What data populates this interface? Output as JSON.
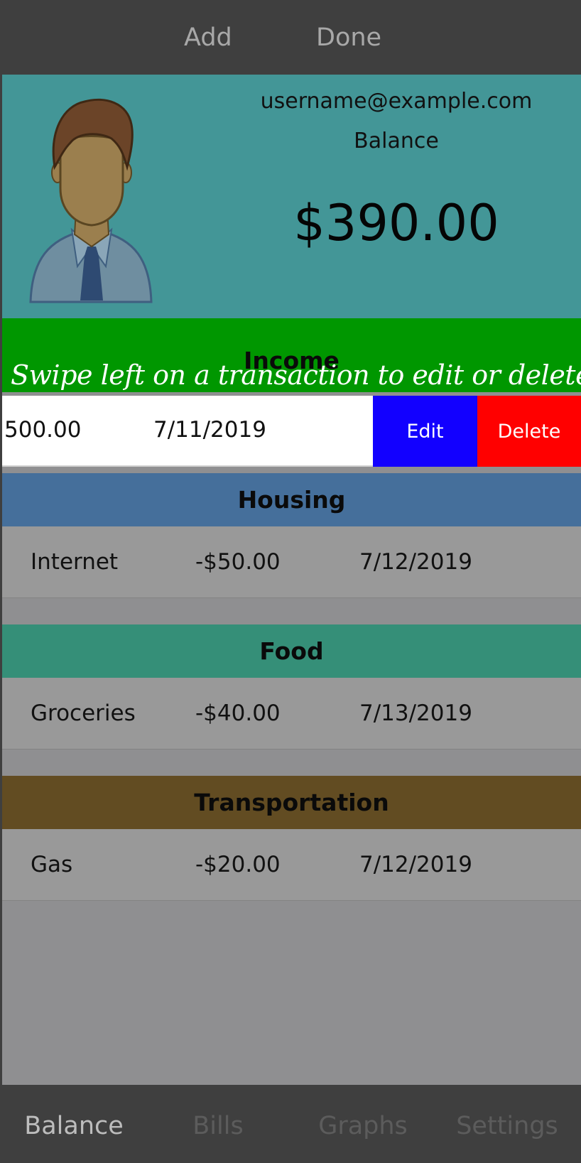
{
  "navbar": {
    "add_label": "Add",
    "done_label": "Done"
  },
  "profile": {
    "email": "username@example.com",
    "balance_label": "Balance",
    "balance_amount": "$390.00"
  },
  "income": {
    "title": "Income",
    "swipe_hint": "Swipe left on a transaction to edit or delete it",
    "row": {
      "amount": "500.00",
      "date": "7/11/2019",
      "edit_label": "Edit",
      "delete_label": "Delete"
    }
  },
  "categories": [
    {
      "title": "Housing",
      "color": "#456f9b",
      "rows": [
        {
          "name": "Internet",
          "amount": "-$50.00",
          "date": "7/12/2019"
        }
      ]
    },
    {
      "title": "Food",
      "color": "#358f78",
      "rows": [
        {
          "name": "Groceries",
          "amount": "-$40.00",
          "date": "7/13/2019"
        }
      ]
    },
    {
      "title": "Transportation",
      "color": "#624c22",
      "rows": [
        {
          "name": "Gas",
          "amount": "-$20.00",
          "date": "7/12/2019"
        }
      ]
    }
  ],
  "tabs": [
    {
      "label": "Balance",
      "active": true
    },
    {
      "label": "Bills",
      "active": false
    },
    {
      "label": "Graphs",
      "active": false
    },
    {
      "label": "Settings",
      "active": false
    }
  ],
  "colors": {
    "profile_bg": "#439697",
    "income_bg": "#009700",
    "edit_bg": "#1200ff",
    "delete_bg": "#ff0000"
  }
}
